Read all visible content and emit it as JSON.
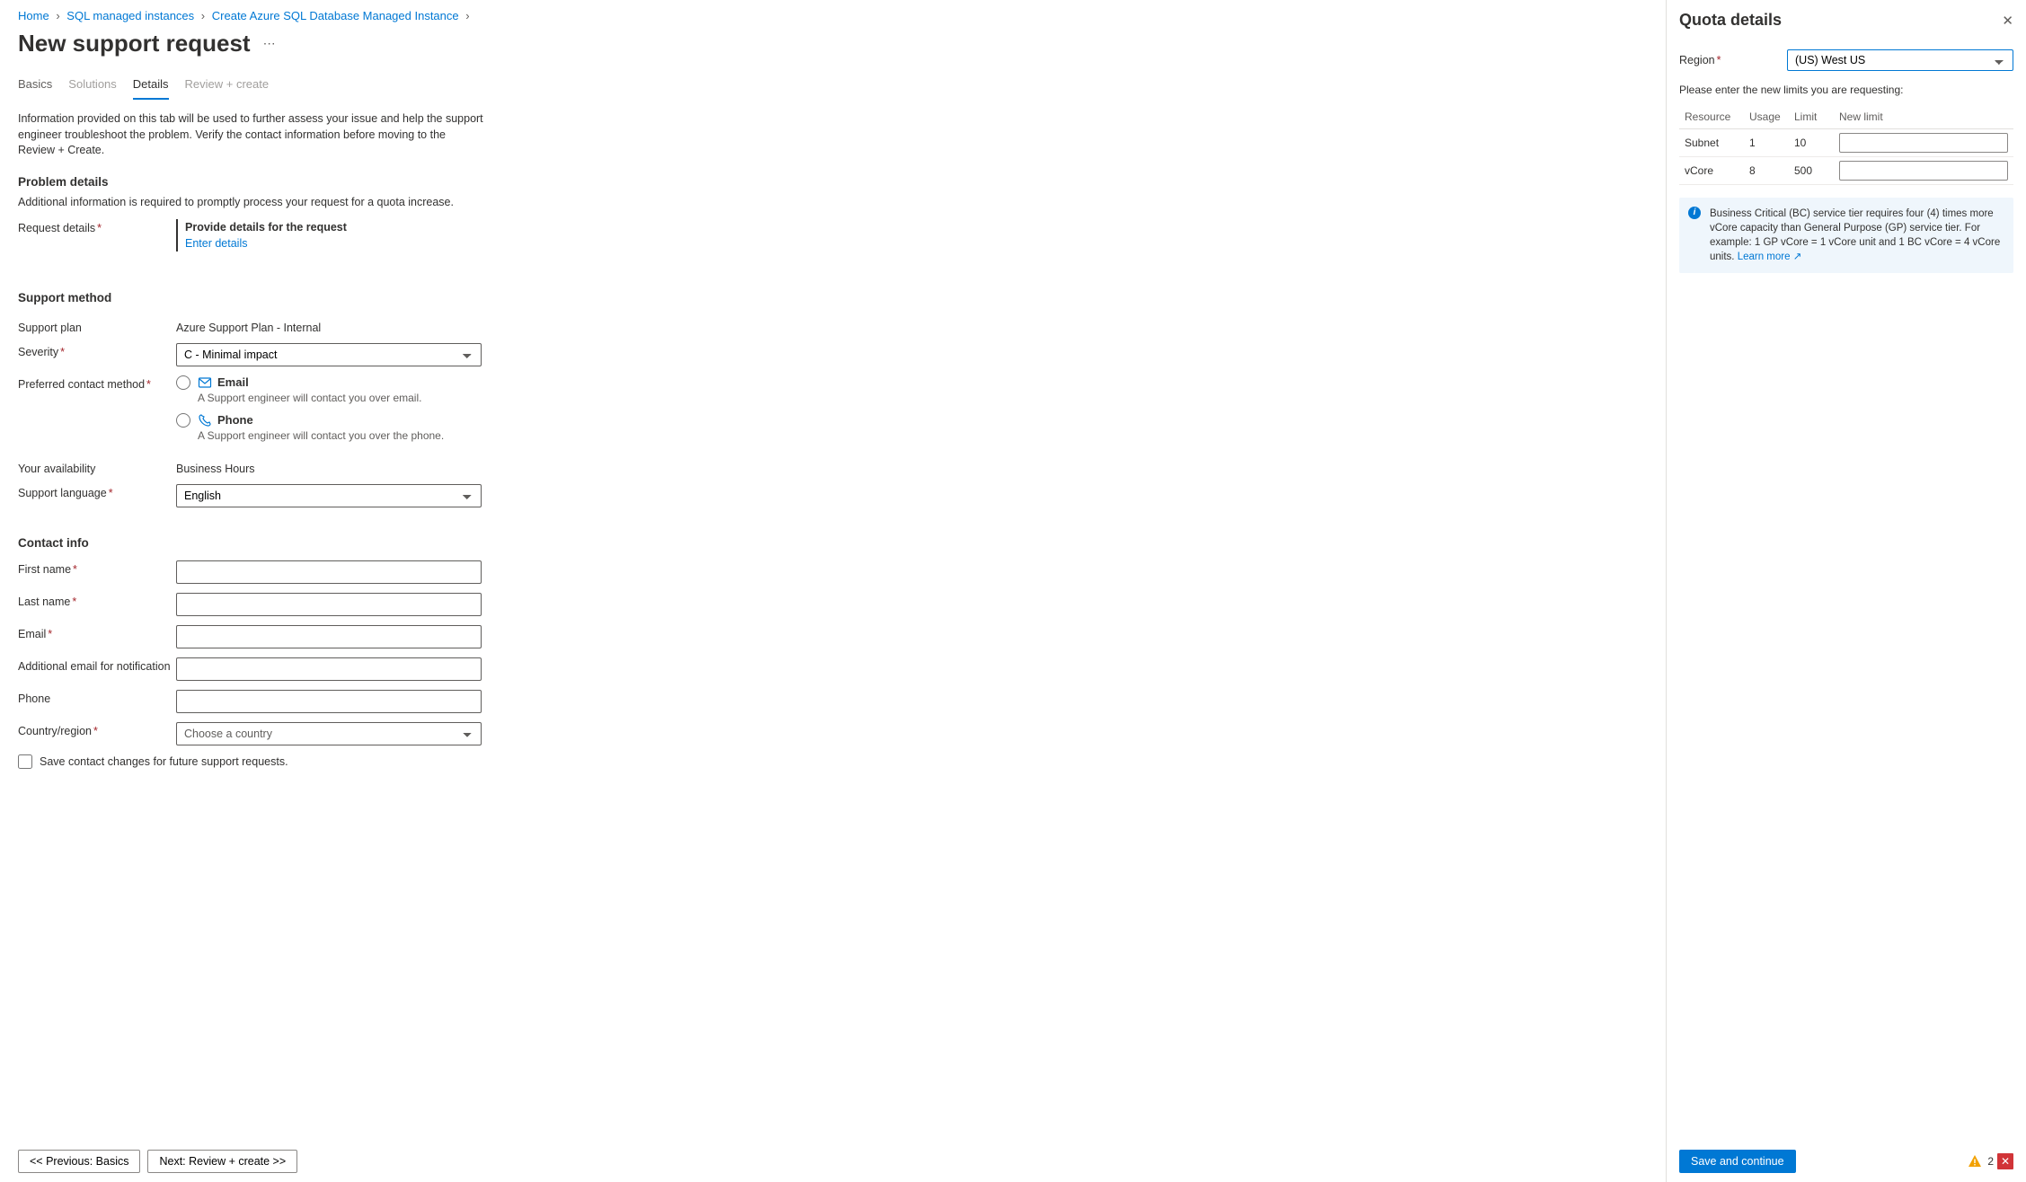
{
  "breadcrumbs": [
    "Home",
    "SQL managed instances",
    "Create Azure SQL Database Managed Instance"
  ],
  "page_title": "New support request",
  "tabs": [
    {
      "label": "Basics",
      "state": "default"
    },
    {
      "label": "Solutions",
      "state": "disabled"
    },
    {
      "label": "Details",
      "state": "active"
    },
    {
      "label": "Review + create",
      "state": "disabled"
    }
  ],
  "intro": "Information provided on this tab will be used to further assess your issue and help the support engineer troubleshoot the problem. Verify the contact information before moving to the Review + Create.",
  "problem": {
    "title": "Problem details",
    "sub": "Additional information is required to promptly process your request for a quota increase.",
    "request_details_label": "Request details",
    "provide_text": "Provide details for the request",
    "enter_link": "Enter details"
  },
  "support": {
    "title": "Support method",
    "plan_label": "Support plan",
    "plan_value": "Azure Support Plan - Internal",
    "severity_label": "Severity",
    "severity_value": "C - Minimal impact",
    "contact_label": "Preferred contact method",
    "email_label": "Email",
    "email_desc": "A Support engineer will contact you over email.",
    "phone_label": "Phone",
    "phone_desc": "A Support engineer will contact you over the phone.",
    "availability_label": "Your availability",
    "availability_value": "Business Hours",
    "language_label": "Support language",
    "language_value": "English"
  },
  "contact": {
    "title": "Contact info",
    "first_name": "First name",
    "last_name": "Last name",
    "email": "Email",
    "add_email": "Additional email for notification",
    "phone": "Phone",
    "country": "Country/region",
    "country_placeholder": "Choose a country",
    "save_label": "Save contact changes for future support requests."
  },
  "footer": {
    "prev": "<< Previous: Basics",
    "next": "Next: Review + create >>"
  },
  "side": {
    "title": "Quota details",
    "region_label": "Region",
    "region_value": "(US) West US",
    "instruction": "Please enter the new limits you are requesting:",
    "headers": {
      "resource": "Resource",
      "usage": "Usage",
      "limit": "Limit",
      "newlimit": "New limit"
    },
    "rows": [
      {
        "resource": "Subnet",
        "usage": "1",
        "limit": "10"
      },
      {
        "resource": "vCore",
        "usage": "8",
        "limit": "500"
      }
    ],
    "info_text": "Business Critical (BC) service tier requires four (4) times more vCore capacity than General Purpose (GP) service tier. For example: 1 GP vCore = 1 vCore unit and 1 BC vCore = 4 vCore units. ",
    "info_link": "Learn more",
    "save_btn": "Save and continue",
    "warn_count": "2"
  }
}
